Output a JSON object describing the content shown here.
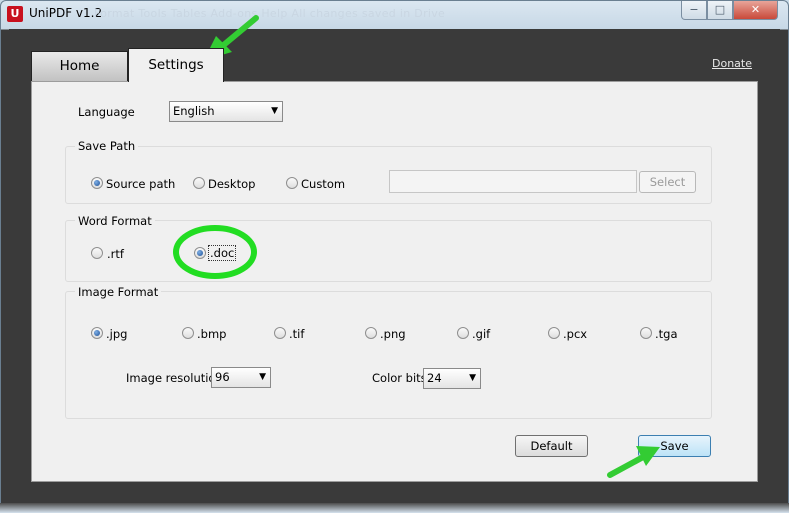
{
  "window": {
    "app_icon": "U",
    "title": "UniPDF v1.2",
    "ghost_menu": "Format   Tools   Tables   Add-ons   Help   All changes saved in Drive",
    "buttons": {
      "minimize": "−",
      "maximize": "□",
      "close": "✕"
    }
  },
  "tabs": {
    "home": "Home",
    "settings": "Settings"
  },
  "donate_label": "Donate",
  "language": {
    "label": "Language",
    "value": "English"
  },
  "save_path": {
    "title": "Save Path",
    "options": [
      "Source path",
      "Desktop",
      "Custom"
    ],
    "selected": "Source path",
    "custom_value": "",
    "select_button": "Select"
  },
  "word_format": {
    "title": "Word Format",
    "options": [
      ".rtf",
      ".doc"
    ],
    "selected": ".doc"
  },
  "image_format": {
    "title": "Image Format",
    "options": [
      ".jpg",
      ".bmp",
      ".tif",
      ".png",
      ".gif",
      ".pcx",
      ".tga"
    ],
    "selected": ".jpg",
    "resolution_label": "Image resolution",
    "resolution_value": "96",
    "color_bits_label": "Color bits",
    "color_bits_value": "24"
  },
  "buttons": {
    "default": "Default",
    "save": "Save"
  },
  "annotation_colors": {
    "arrow": "#33cc33",
    "highlight_ring": "#22dd22"
  }
}
